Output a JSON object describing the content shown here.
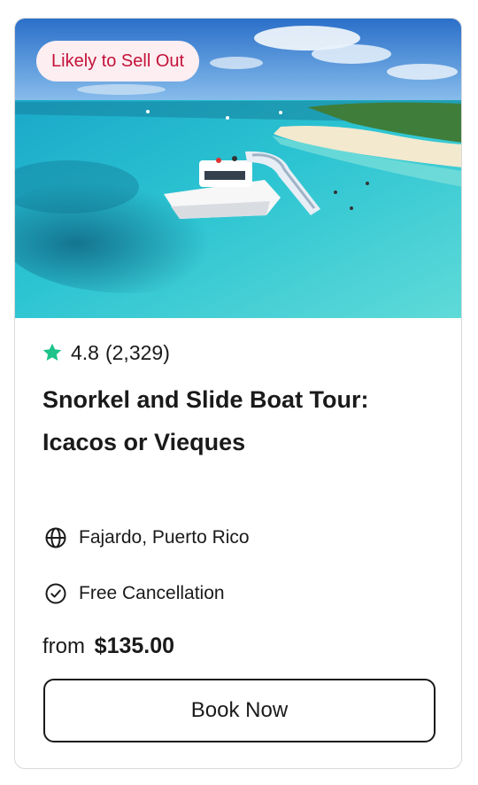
{
  "card": {
    "badge": "Likely to Sell Out",
    "rating": {
      "score": "4.8",
      "count": "(2,329)"
    },
    "title": "Snorkel and Slide Boat Tour: Icacos or Vieques",
    "location": "Fajardo, Puerto Rico",
    "cancellation": "Free Cancellation",
    "price": {
      "prefix": "from",
      "amount": "$135.00"
    },
    "cta": "Book Now"
  },
  "icons": {
    "rating": "star-icon",
    "location": "globe-icon",
    "cancellation": "check-circle-icon"
  },
  "colors": {
    "badge_text": "#c4123a",
    "badge_bg": "#fdeef1",
    "star": "#1ec28b",
    "text": "#1a1a1a"
  }
}
